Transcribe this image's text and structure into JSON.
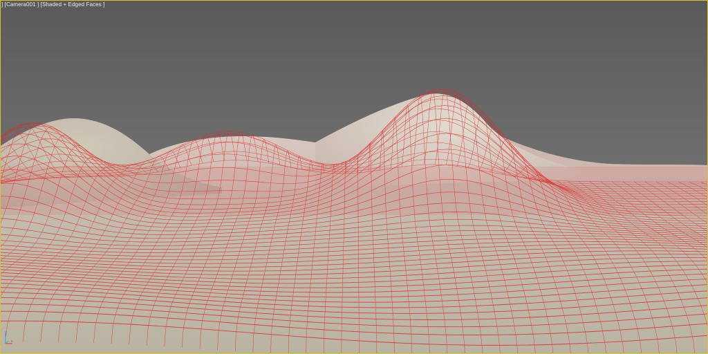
{
  "viewport": {
    "label": "] [Camera001 ] [Shaded + Edged Faces ]",
    "active_border_color": "#d8c23a",
    "background_color": "#6a6a6a"
  },
  "terrain": {
    "surface_color": "#cfc9b8",
    "wire_color": "#e02a2a"
  },
  "axis_gizmo": {
    "icon": "axis-tripod-icon"
  }
}
